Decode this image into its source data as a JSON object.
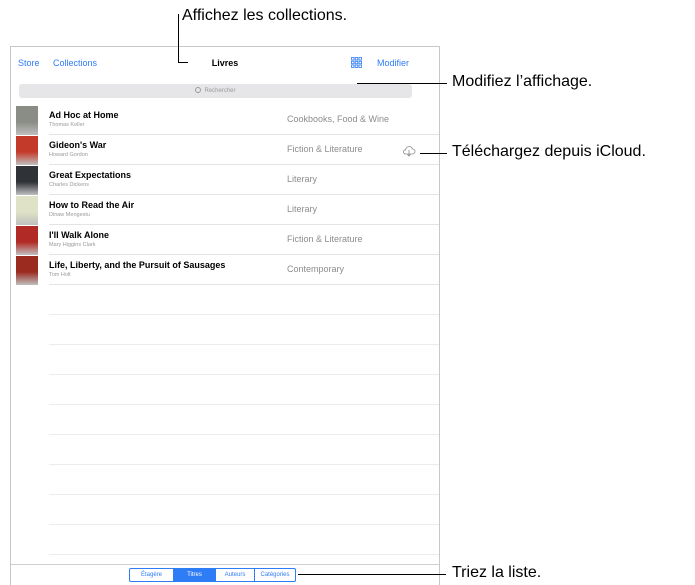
{
  "callouts": {
    "collections": "Affichez les collections.",
    "affichage": "Modifiez l’affichage.",
    "icloud": "Téléchargez depuis iCloud.",
    "tri": "Triez la liste."
  },
  "nav": {
    "store": "Store",
    "collections": "Collections",
    "title": "Livres",
    "edit": "Modifier",
    "grid_icon": "grid-view-icon"
  },
  "search": {
    "placeholder": "Rechercher",
    "icon": "search-icon"
  },
  "books": [
    {
      "title": "Ad Hoc at Home",
      "author": "Thomas Keller",
      "category": "Cookbooks, Food & Wine",
      "cover_color": "#8a8d86"
    },
    {
      "title": "Gideon's War",
      "author": "Howard Gordon",
      "category": "Fiction & Literature",
      "cover_color": "#c43a2a",
      "download": true
    },
    {
      "title": "Great Expectations",
      "author": "Charles Dickens",
      "category": "Literary",
      "cover_color": "#2f3236"
    },
    {
      "title": "How to Read the Air",
      "author": "Dinaw Mengestu",
      "category": "Literary",
      "cover_color": "#dfe2c6"
    },
    {
      "title": "I'll Walk Alone",
      "author": "Mary Higgins Clark",
      "category": "Fiction & Literature",
      "cover_color": "#b22a25"
    },
    {
      "title": "Life, Liberty, and the Pursuit of Sausages",
      "author": "Tom Holt",
      "category": "Contemporary",
      "cover_color": "#9c2b1f"
    }
  ],
  "sort_tabs": [
    {
      "label": "Étagère",
      "active": false
    },
    {
      "label": "Titres",
      "active": true
    },
    {
      "label": "Auteurs",
      "active": false
    },
    {
      "label": "Catégories",
      "active": false
    }
  ],
  "colors": {
    "accent": "#2e7cf6"
  }
}
